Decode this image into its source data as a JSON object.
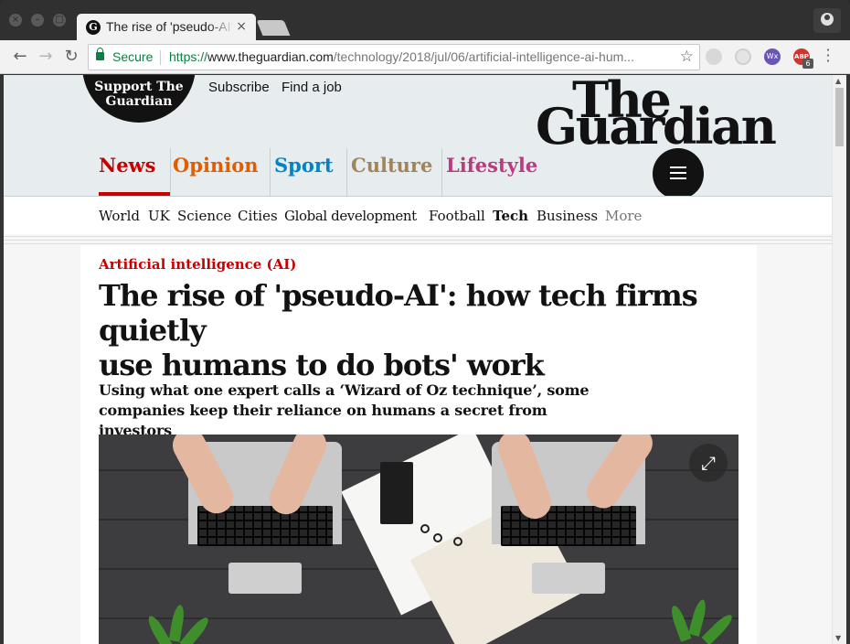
{
  "browser": {
    "tab_title": "The rise of 'pseudo-AI': how tech firms quietly use humans to do bots' work",
    "tab_favicon": "G",
    "tab_close": "×",
    "security_label": "Secure",
    "url_scheme": "https://",
    "url_host": "www.theguardian.com",
    "url_path": "/technology/2018/jul/06/artificial-intelligence-ai-hum...",
    "adblock_label": "ABP",
    "adblock_count": "6",
    "ext3_label": "Wx"
  },
  "guardian": {
    "support_line1": "Support The",
    "support_line2": "Guardian",
    "subscribe": "Subscribe",
    "find_job": "Find a job",
    "logo_line1": "The",
    "logo_line2": "Guardian",
    "pillars": [
      "News",
      "Opinion",
      "Sport",
      "Culture",
      "Lifestyle"
    ],
    "pillar_colors": {
      "news": "#c70000",
      "opinion": "#e05e00",
      "sport": "#0084c6",
      "culture": "#a1845c",
      "lifestyle": "#bb3b80"
    },
    "subnav": [
      "World",
      "UK",
      "Science",
      "Cities",
      "Global development",
      "Football",
      "Tech",
      "Business",
      "More"
    ],
    "active_subnav": "Tech"
  },
  "article": {
    "kicker": "Artificial intelligence (AI)",
    "headline_line1": "The rise of 'pseudo-AI': how tech firms quietly",
    "headline_line2": "use humans to do bots' work",
    "standfirst_line1": "Using what one expert calls a ‘Wizard of Oz technique’, some",
    "standfirst_line2": "companies keep their reliance on humans a secret from investors",
    "image_icon": "expand-icon"
  }
}
